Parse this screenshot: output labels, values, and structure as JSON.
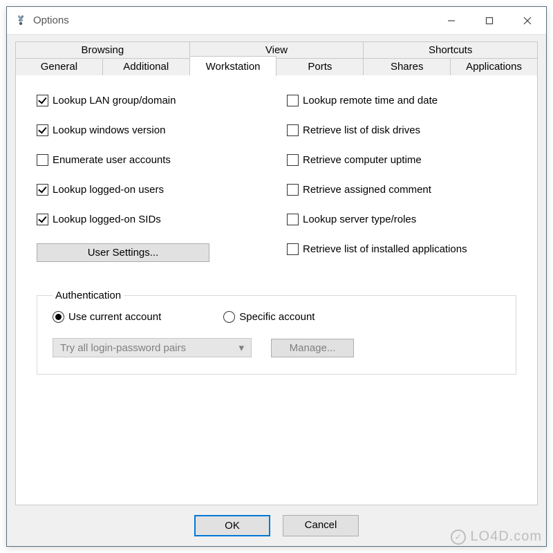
{
  "window": {
    "title": "Options"
  },
  "tabs": {
    "top": [
      "Browsing",
      "View",
      "Shortcuts"
    ],
    "bottom": [
      "General",
      "Additional",
      "Workstation",
      "Ports",
      "Shares",
      "Applications"
    ],
    "active": "Workstation"
  },
  "left_checks": [
    {
      "label": "Lookup LAN group/domain",
      "checked": true
    },
    {
      "label": "Lookup windows version",
      "checked": true
    },
    {
      "label": "Enumerate user accounts",
      "checked": false
    },
    {
      "label": "Lookup logged-on users",
      "checked": true
    },
    {
      "label": "Lookup logged-on SIDs",
      "checked": true
    }
  ],
  "right_checks": [
    {
      "label": "Lookup remote time and date",
      "checked": false
    },
    {
      "label": "Retrieve list of disk drives",
      "checked": false
    },
    {
      "label": "Retrieve computer uptime",
      "checked": false
    },
    {
      "label": "Retrieve assigned comment",
      "checked": false
    },
    {
      "label": "Lookup server type/roles",
      "checked": false
    },
    {
      "label": "Retrieve list of installed applications",
      "checked": false
    }
  ],
  "user_settings_button": "User Settings...",
  "auth": {
    "legend": "Authentication",
    "radios": {
      "current": "Use current account",
      "specific": "Specific account"
    },
    "selected": "current",
    "combo_value": "Try all login-password pairs",
    "manage": "Manage..."
  },
  "dialog": {
    "ok": "OK",
    "cancel": "Cancel"
  },
  "watermark": "LO4D.com"
}
